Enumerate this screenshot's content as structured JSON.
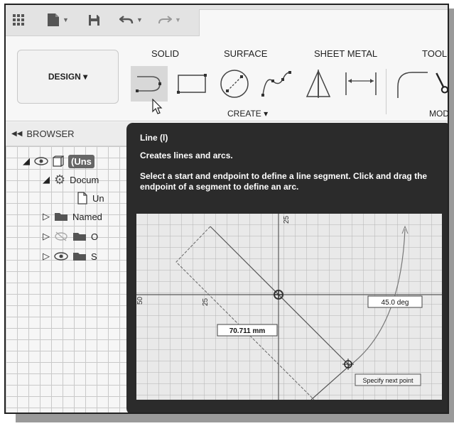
{
  "ribbon": {
    "workspace_button": "DESIGN ▾",
    "tabs": [
      "SOLID",
      "SURFACE",
      "SHEET METAL",
      "TOOLS"
    ],
    "create_label": "CREATE ▾",
    "modify_label": "MODIF"
  },
  "browser": {
    "header": "BROWSER",
    "rows": [
      {
        "label": "(Uns"
      },
      {
        "label": "Docum"
      },
      {
        "label": "Un"
      },
      {
        "label": "Named"
      },
      {
        "label": "O"
      },
      {
        "label": "S"
      }
    ]
  },
  "tooltip": {
    "title": "Line (l)",
    "subtitle": "Creates lines and arcs.",
    "description": "Select a start and endpoint to define a line segment. Click and drag the endpoint of a segment to define an arc.",
    "illustration": {
      "dimension_length": "70.711 mm",
      "angle": "45.0 deg",
      "prompt": "Specify next point",
      "axis_label_a": "25",
      "axis_label_b": "25",
      "axis_label_c": "50"
    }
  }
}
